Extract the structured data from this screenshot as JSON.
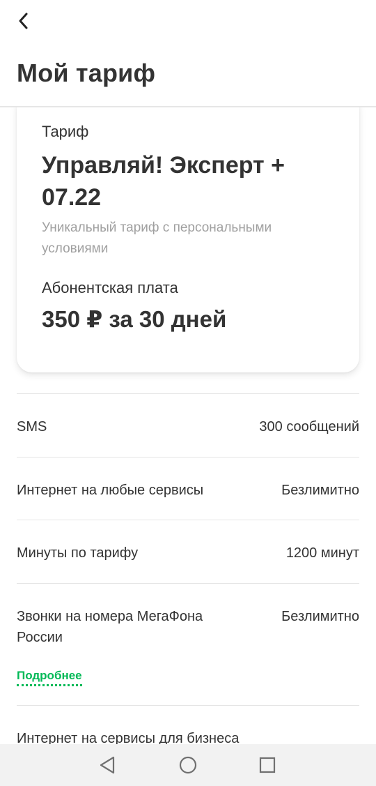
{
  "header": {
    "title": "Мой тариф",
    "back_icon": "chevron-left-icon"
  },
  "card": {
    "label": "Тариф",
    "tariff_name": "Управляй! Эксперт + 07.22",
    "description": "Уникальный тариф с персональными условиями",
    "fee_label": "Абонентская плата",
    "fee_value": "350 ₽ за 30 дней"
  },
  "options": [
    {
      "title": "SMS",
      "value": "300 сообщений"
    },
    {
      "title": "Интернет на любые сервисы",
      "value": "Безлимитно"
    },
    {
      "title": "Минуты по тарифу",
      "value": "1200 минут"
    },
    {
      "title": "Звонки на номера МегаФона России",
      "value": "Безлимитно",
      "link": "Подробнее"
    },
    {
      "title": "Интернет на сервисы для бизнеса"
    }
  ],
  "navbar": {
    "back_icon": "triangle-back-icon",
    "home_icon": "circle-home-icon",
    "recents_icon": "square-recents-icon"
  },
  "colors": {
    "accent": "#00b956",
    "text": "#333333",
    "secondary_text": "#a0a0a0",
    "divider": "#e5e5e5",
    "navbar_bg": "#f2f2f2"
  }
}
